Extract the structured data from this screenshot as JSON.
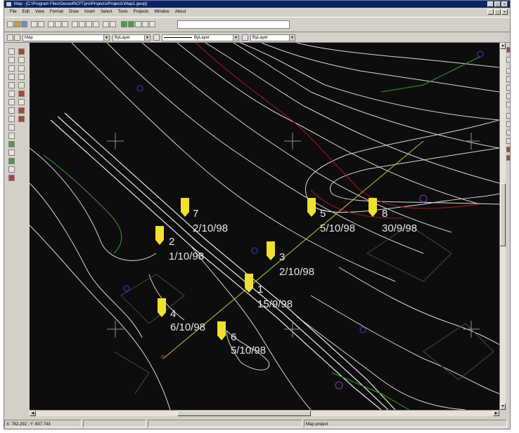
{
  "titlebar": {
    "title": "Map - [C:\\Program Files\\Geosoft\\CFTpro\\Projects\\Project1\\Map1.geop]",
    "min": "_",
    "max": "□",
    "close": "×"
  },
  "menu": [
    "File",
    "Edit",
    "View",
    "Format",
    "Draw",
    "Insert",
    "Select",
    "Tools",
    "Projects",
    "Window",
    "About"
  ],
  "toolbar2": {
    "map_combo": "Map",
    "layer_combo": "ByLayer",
    "linetype_combo": "ByLayer",
    "lineweight_combo": "ByLayer"
  },
  "markers": [
    {
      "id": "7",
      "date": "2/10/98"
    },
    {
      "id": "2",
      "date": "1/10/98"
    },
    {
      "id": "5",
      "date": "5/10/98"
    },
    {
      "id": "8",
      "date": "30/9/98"
    },
    {
      "id": "3",
      "date": "2/10/98"
    },
    {
      "id": "1",
      "date": "15/9/98"
    },
    {
      "id": "4",
      "date": "6/10/98"
    },
    {
      "id": "6",
      "date": "5/10/98"
    }
  ],
  "statusbar": {
    "coords": "X: 782.292 ; Y: 837.743",
    "project": "Map project"
  },
  "colors": {
    "canvas": "#0d0d0d",
    "marker": "#f0e030",
    "contour": "#d8d8d8",
    "contour_red": "#a02020",
    "green": "#2fa02f",
    "road": "#e8e8e8",
    "survey_line": "#c8c040"
  }
}
